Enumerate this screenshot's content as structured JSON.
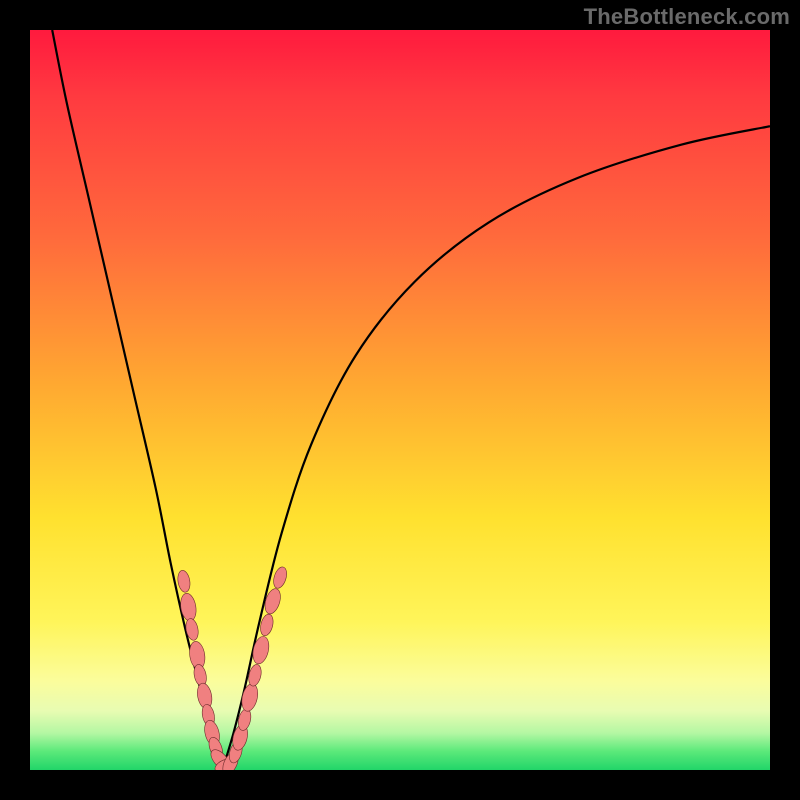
{
  "watermark": "TheBottleneck.com",
  "colors": {
    "bg_black": "#000000",
    "curve": "#000000",
    "bead_fill": "#f08080",
    "bead_stroke": "#6b2a2a",
    "grad_top": "#ff1a3e",
    "grad_bottom": "#21d569"
  },
  "chart_data": {
    "type": "line",
    "title": "",
    "xlabel": "",
    "ylabel": "",
    "xlim": [
      0,
      100
    ],
    "ylim": [
      0,
      100
    ],
    "series": [
      {
        "name": "curve-left",
        "x": [
          3,
          5,
          8,
          11,
          14,
          17,
          19,
          21,
          23,
          24.5,
          26
        ],
        "y": [
          100,
          90,
          77,
          64,
          51,
          38,
          28,
          19,
          11,
          5,
          0
        ]
      },
      {
        "name": "curve-right",
        "x": [
          26,
          27.5,
          29,
          31,
          34,
          38,
          44,
          52,
          62,
          74,
          88,
          100
        ],
        "y": [
          0,
          5,
          11,
          20,
          32,
          44,
          56,
          66,
          74,
          80,
          84.5,
          87
        ]
      }
    ],
    "beads": {
      "name": "highlight-beads",
      "points": [
        {
          "x": 20.8,
          "y": 25.5,
          "r": 1.1
        },
        {
          "x": 21.4,
          "y": 22.0,
          "r": 1.4
        },
        {
          "x": 21.9,
          "y": 19.0,
          "r": 1.1
        },
        {
          "x": 22.6,
          "y": 15.5,
          "r": 1.4
        },
        {
          "x": 23.0,
          "y": 12.8,
          "r": 1.1
        },
        {
          "x": 23.6,
          "y": 10.0,
          "r": 1.3
        },
        {
          "x": 24.1,
          "y": 7.4,
          "r": 1.1
        },
        {
          "x": 24.6,
          "y": 5.0,
          "r": 1.3
        },
        {
          "x": 25.1,
          "y": 3.0,
          "r": 1.1
        },
        {
          "x": 25.7,
          "y": 1.4,
          "r": 1.2
        },
        {
          "x": 26.4,
          "y": 0.6,
          "r": 1.1
        },
        {
          "x": 27.1,
          "y": 0.9,
          "r": 1.2
        },
        {
          "x": 27.8,
          "y": 2.4,
          "r": 1.1
        },
        {
          "x": 28.4,
          "y": 4.4,
          "r": 1.3
        },
        {
          "x": 29.0,
          "y": 6.8,
          "r": 1.1
        },
        {
          "x": 29.7,
          "y": 9.8,
          "r": 1.4
        },
        {
          "x": 30.4,
          "y": 12.8,
          "r": 1.1
        },
        {
          "x": 31.2,
          "y": 16.2,
          "r": 1.4
        },
        {
          "x": 32.0,
          "y": 19.6,
          "r": 1.1
        },
        {
          "x": 32.8,
          "y": 22.8,
          "r": 1.3
        },
        {
          "x": 33.8,
          "y": 26.0,
          "r": 1.1
        }
      ]
    }
  }
}
